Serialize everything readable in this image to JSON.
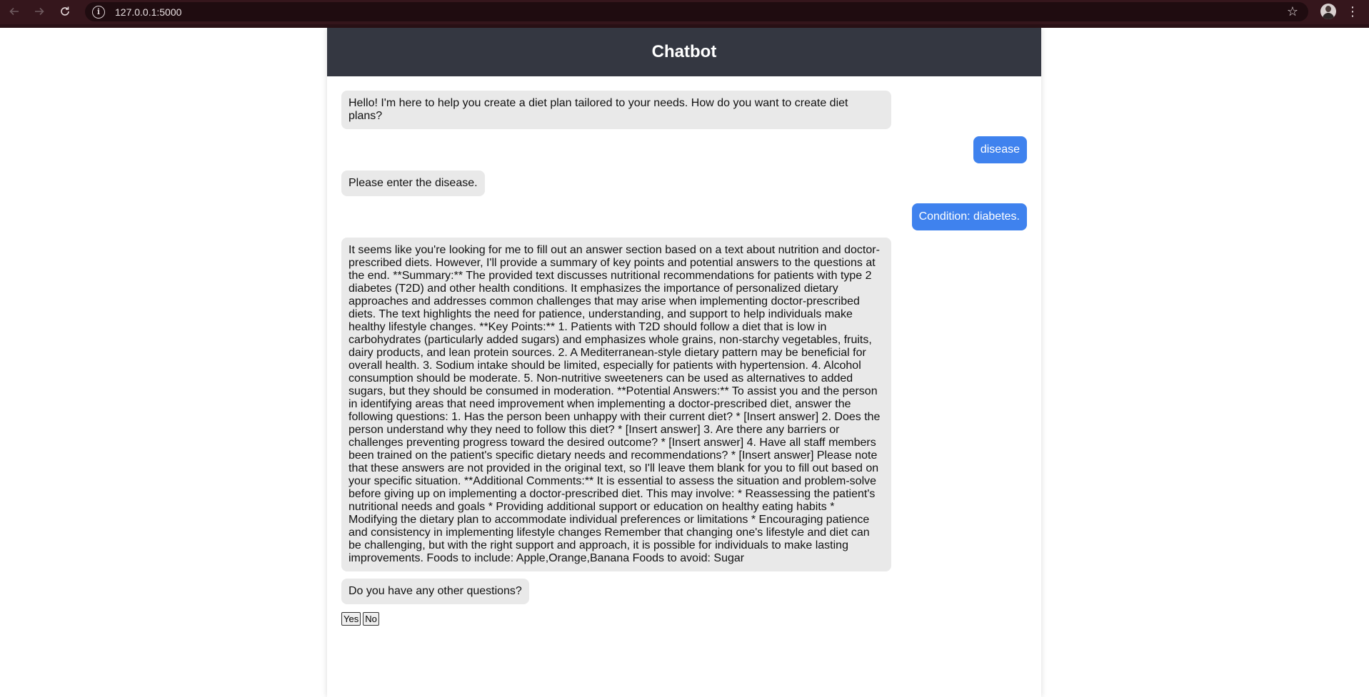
{
  "browser": {
    "url": "127.0.0.1:5000"
  },
  "app": {
    "title": "Chatbot"
  },
  "messages": [
    {
      "role": "bot",
      "text": "Hello! I'm here to help you create a diet plan tailored to your needs. How do you want to create diet plans?"
    },
    {
      "role": "user",
      "text": "disease"
    },
    {
      "role": "bot",
      "text": "Please enter the disease."
    },
    {
      "role": "user",
      "text": "Condition: diabetes."
    },
    {
      "role": "bot",
      "text": "It seems like you're looking for me to fill out an answer section based on a text about nutrition and doctor-prescribed diets. However, I'll provide a summary of key points and potential answers to the questions at the end. **Summary:** The provided text discusses nutritional recommendations for patients with type 2 diabetes (T2D) and other health conditions. It emphasizes the importance of personalized dietary approaches and addresses common challenges that may arise when implementing doctor-prescribed diets. The text highlights the need for patience, understanding, and support to help individuals make healthy lifestyle changes. **Key Points:** 1. Patients with T2D should follow a diet that is low in carbohydrates (particularly added sugars) and emphasizes whole grains, non-starchy vegetables, fruits, dairy products, and lean protein sources. 2. A Mediterranean-style dietary pattern may be beneficial for overall health. 3. Sodium intake should be limited, especially for patients with hypertension. 4. Alcohol consumption should be moderate. 5. Non-nutritive sweeteners can be used as alternatives to added sugars, but they should be consumed in moderation. **Potential Answers:** To assist you and the person in identifying areas that need improvement when implementing a doctor-prescribed diet, answer the following questions: 1. Has the person been unhappy with their current diet? * [Insert answer] 2. Does the person understand why they need to follow this diet? * [Insert answer] 3. Are there any barriers or challenges preventing progress toward the desired outcome? * [Insert answer] 4. Have all staff members been trained on the patient's specific dietary needs and recommendations? * [Insert answer] Please note that these answers are not provided in the original text, so I'll leave them blank for you to fill out based on your specific situation. **Additional Comments:** It is essential to assess the situation and problem-solve before giving up on implementing a doctor-prescribed diet. This may involve: * Reassessing the patient's nutritional needs and goals * Providing additional support or education on healthy eating habits * Modifying the dietary plan to accommodate individual preferences or limitations * Encouraging patience and consistency in implementing lifestyle changes Remember that changing one's lifestyle and diet can be challenging, but with the right support and approach, it is possible for individuals to make lasting improvements. Foods to include: Apple,Orange,Banana Foods to avoid: Sugar"
    },
    {
      "role": "bot",
      "text": "Do you have any other questions?"
    }
  ],
  "choices": {
    "yes_label": "Yes",
    "no_label": "No"
  },
  "colors": {
    "header_bg": "#343741",
    "user_bubble": "#3f82ee",
    "bot_bubble": "#e9e9e9",
    "browser_frame": "#35161c"
  },
  "icons": {
    "back": "arrow-left-icon",
    "forward": "arrow-right-icon",
    "reload": "reload-icon",
    "site_info": "info-icon",
    "bookmark": "star-icon",
    "profile": "avatar",
    "menu": "more-vert-icon"
  }
}
